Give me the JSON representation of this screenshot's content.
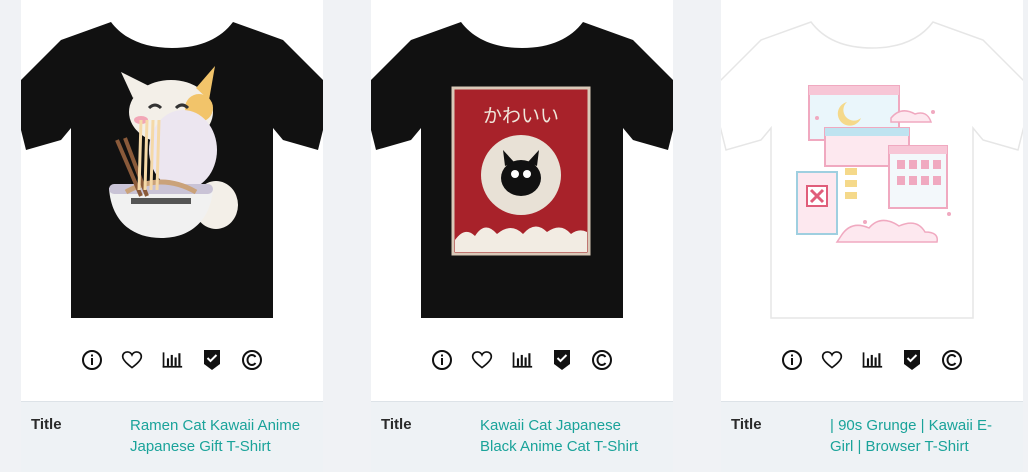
{
  "products": [
    {
      "title_label": "Title",
      "title": "Ramen Cat Kawaii Anime Japanese Gift T-Shirt",
      "shirt_color": "#111111",
      "print_text": ""
    },
    {
      "title_label": "Title",
      "title": "Kawaii Cat Japanese Black Anime Cat T-Shirt",
      "shirt_color": "#111111",
      "print_text": "かわいい"
    },
    {
      "title_label": "Title",
      "title": "| 90s Grunge | Kawaii E-Girl | Browser T-Shirt",
      "shirt_color": "#ffffff",
      "print_text": ""
    }
  ],
  "actions": [
    "info-icon",
    "heart-icon",
    "bar-chart-icon",
    "shield-check-icon",
    "copyright-icon"
  ],
  "colors": {
    "link": "#1aa39a",
    "meta_bg": "#eef2f5",
    "page_bg": "#f0f2f5"
  }
}
